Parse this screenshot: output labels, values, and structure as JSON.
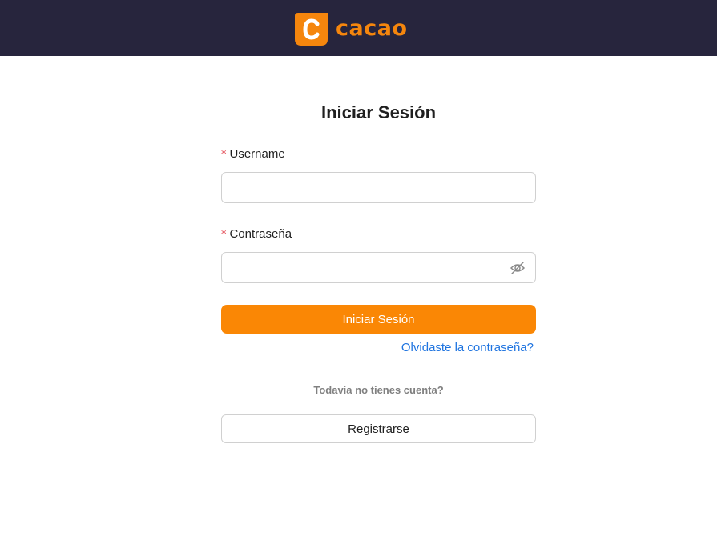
{
  "header": {
    "brand_name": "cacao",
    "brand_color": "#f5860d",
    "background_color": "#27253d"
  },
  "login": {
    "title": "Iniciar Sesión",
    "username_label": "Username",
    "username_value": "",
    "password_label": "Contraseña",
    "password_value": "",
    "password_toggle_icon": "eye-off-icon",
    "submit_label": "Iniciar Sesión",
    "forgot_link": "Olvidaste la contraseña?",
    "divider_text": "Todavia no tienes cuenta?",
    "register_label": "Registrarse",
    "required_marker": "*",
    "accent_color": "#fa8705",
    "link_color": "#1f74e0"
  }
}
